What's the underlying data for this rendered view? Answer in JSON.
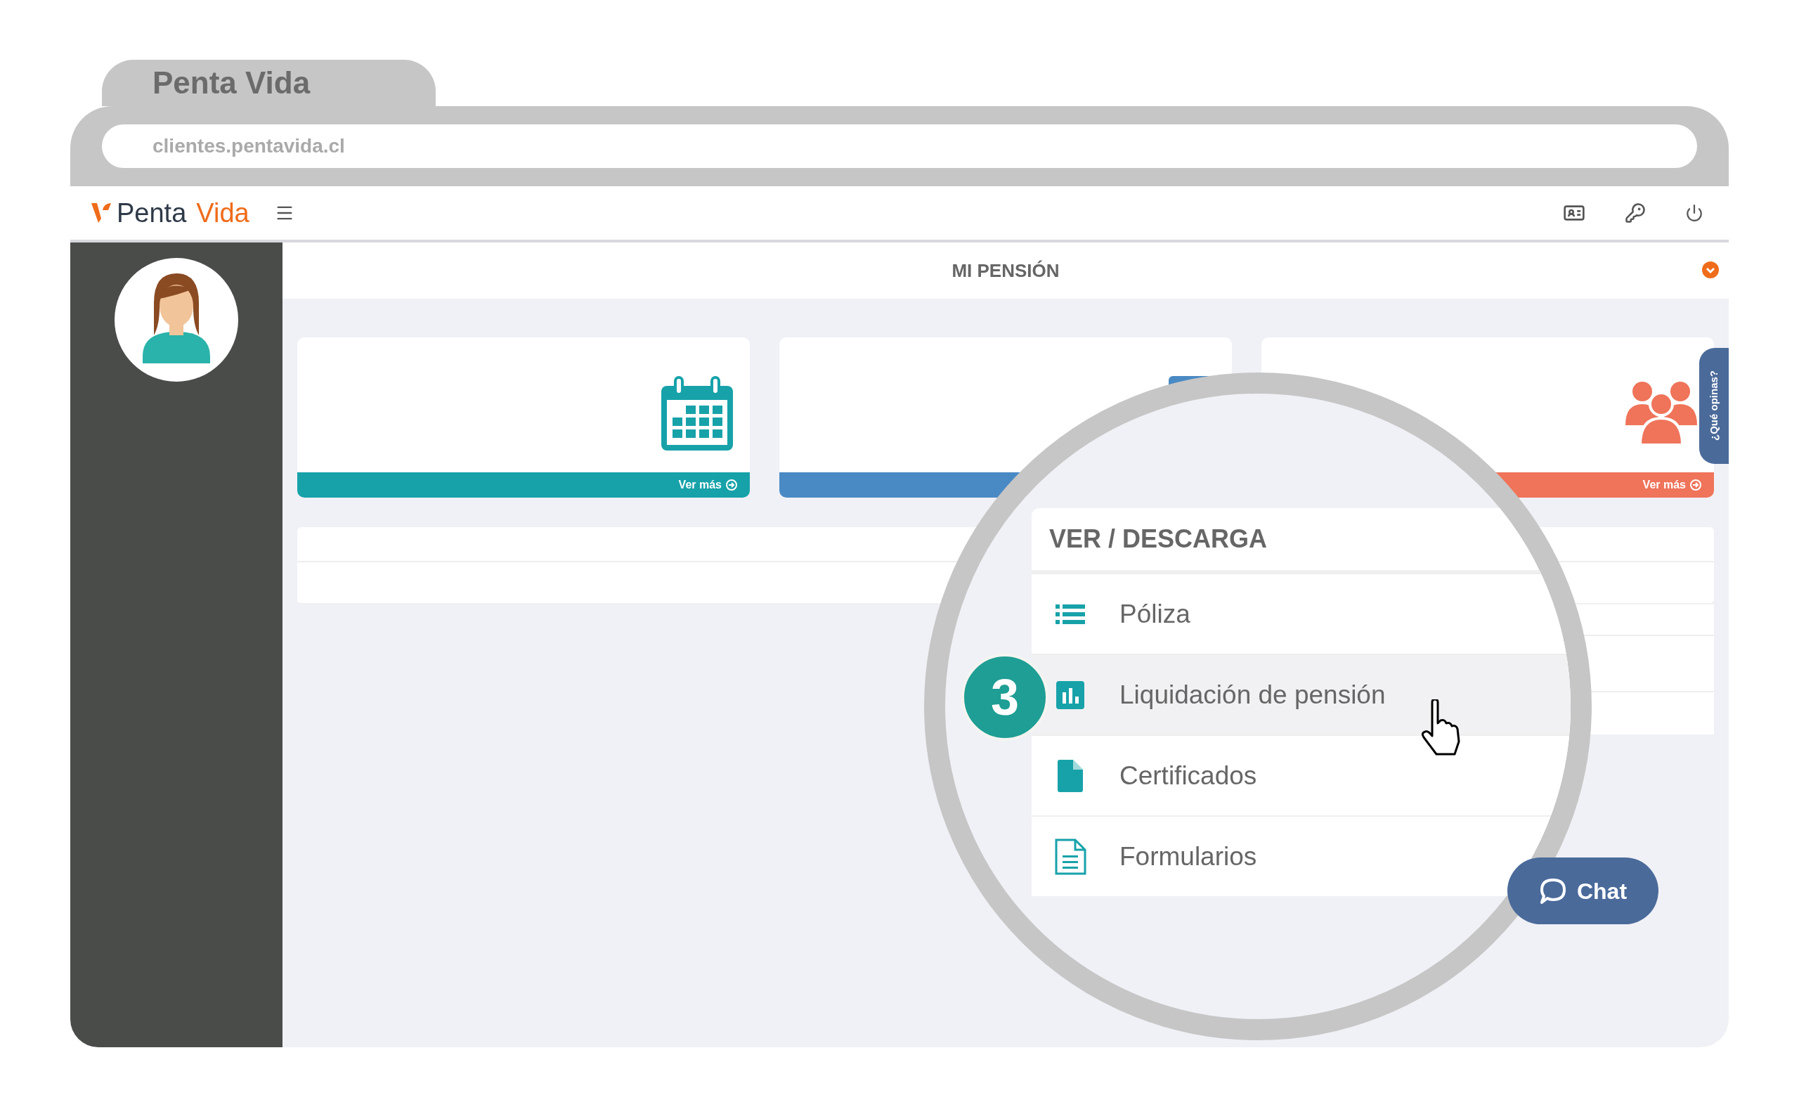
{
  "browser": {
    "tab_title": "Penta Vida",
    "url": "clientes.pentavida.cl"
  },
  "header": {
    "logo": {
      "first": "Penta",
      "second": "Vida"
    }
  },
  "section_title": "MI PENSIÓN",
  "cards": [
    {
      "kind": "calendar",
      "color": "#17a2a9",
      "link": "Ver más"
    },
    {
      "kind": "covered",
      "color": "#4a8ac4"
    },
    {
      "kind": "people",
      "color": "#ef745a",
      "link": "Ver más"
    }
  ],
  "feedback_tab": "¿Qué opinas?",
  "magnifier": {
    "step": "3",
    "menu": {
      "title": "VER / DESCARGA",
      "items": [
        {
          "kind": "list",
          "label": "Póliza",
          "selected": false
        },
        {
          "kind": "chart",
          "label": "Liquidación de pensión",
          "selected": true
        },
        {
          "kind": "file",
          "label": "Certificados",
          "selected": false
        },
        {
          "kind": "form",
          "label": "Formularios",
          "selected": false
        }
      ]
    }
  },
  "chat_button": "Chat"
}
